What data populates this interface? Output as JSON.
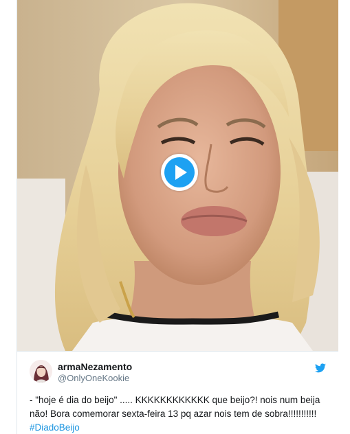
{
  "tweet": {
    "display_name": "armaNezamento",
    "handle": "@OnlyOneKookie",
    "text_before": "- \"hoje é dia do beijo\" ..... KKKKKKKKKKKK que beijo?! nois num beija não! Bora comemorar sexta-feira 13 pq azar nois tem de sobra!!!!!!!!!!! ",
    "hashtag": "#DiadoBeijo"
  },
  "icons": {
    "play": "play-icon",
    "brand": "twitter-bird-icon"
  },
  "colors": {
    "accent": "#1da1f2",
    "hashtag": "#1b95e0",
    "border": "#e1e8ed"
  }
}
